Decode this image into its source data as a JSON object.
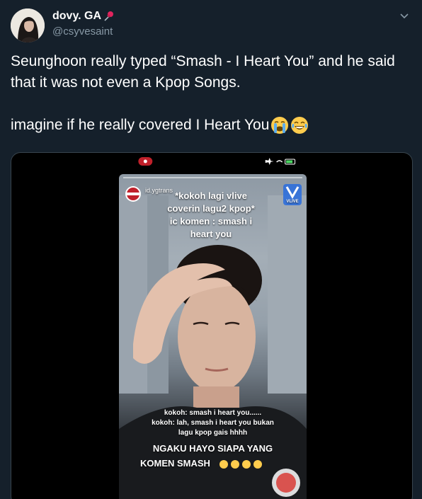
{
  "tweet": {
    "display_name": "dovy. GA",
    "handle": "@csyvesaint",
    "text_line1": "Seunghoon really typed “Smash - I Heart You” and he said that it was not even a Kpop Songs.",
    "text_line2": "imagine if he really covered I Heart You",
    "emojis": [
      "loudly-crying-face-emoji",
      "face-with-tears-of-joy-emoji"
    ]
  },
  "media": {
    "story_user": "id.ygtrans",
    "vlive_label": "VLIVE",
    "caption_top": [
      "*kokoh lagi vlive",
      "coverin lagu2 kpop*",
      "ic komen : smash i",
      "heart you"
    ],
    "subtitle_1": "kokoh: smash i heart you......",
    "subtitle_2": "kokoh: lah, smash i heart you bukan",
    "subtitle_3": "lagu kpop gais hhhh",
    "caption_bottom_1": "NGAKU HAYO SIAPA YANG",
    "caption_bottom_2": "KOMEN SMASH"
  },
  "colors": {
    "background": "#15202b",
    "muted_text": "#8899a6",
    "border": "#38444d",
    "pin": "#e0245e"
  }
}
